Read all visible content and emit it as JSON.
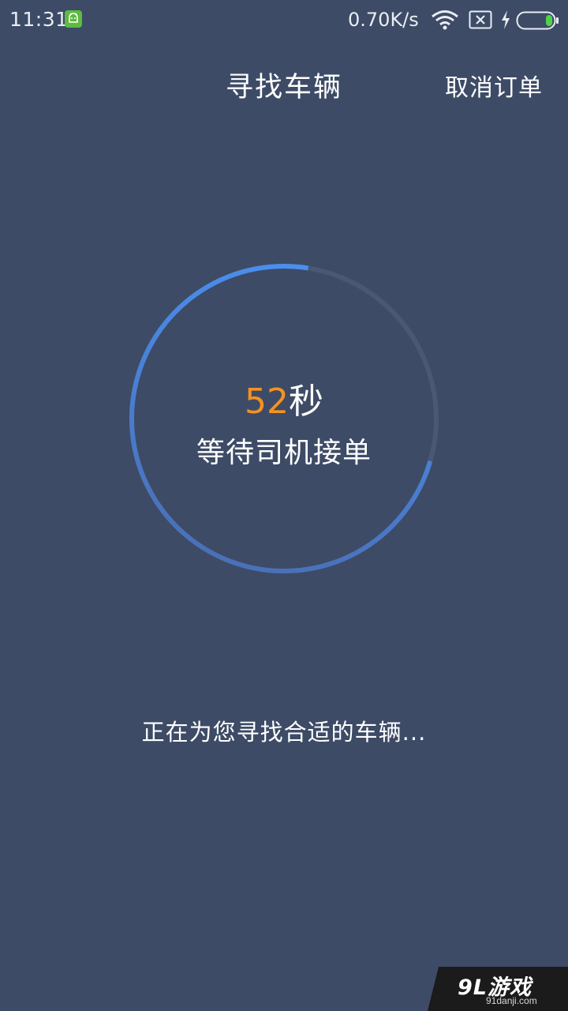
{
  "status_bar": {
    "time": "11:31",
    "net_speed": "0.70K/s",
    "icons": [
      "android-notification-icon",
      "wifi-icon",
      "no-sim-icon",
      "charging-icon",
      "battery-icon"
    ]
  },
  "header": {
    "title": "寻找车辆",
    "cancel_label": "取消订单"
  },
  "countdown": {
    "seconds": "52",
    "unit": "秒",
    "label": "等待司机接单",
    "progress_fraction": 0.27
  },
  "message": "正在为您寻找合适的车辆...",
  "watermark": {
    "logo": "9L游戏",
    "url": "91danji.com"
  },
  "colors": {
    "background": "#3d4b66",
    "ring_track": "#4a5873",
    "ring_progress": "#4a8ff0",
    "countdown_number": "#f5921f",
    "battery_level": "#4fd34a"
  }
}
